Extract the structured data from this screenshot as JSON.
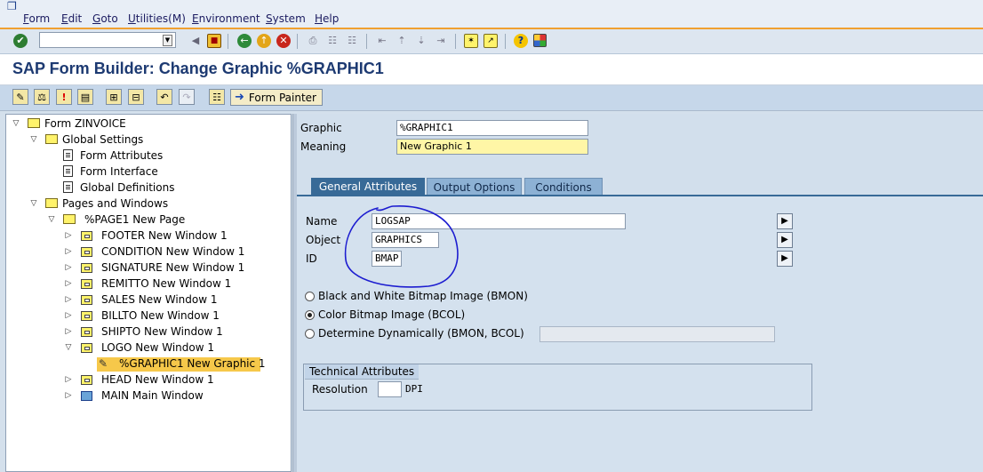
{
  "menubar": {
    "items": [
      "Form",
      "Edit",
      "Goto",
      "Utilities(M)",
      "Environment",
      "System",
      "Help"
    ]
  },
  "toolbar": {
    "command_value": ""
  },
  "page_title": "SAP Form Builder: Change Graphic %GRAPHIC1",
  "app_toolbar": {
    "form_painter_label": "Form Painter"
  },
  "tree": {
    "form": "Form ZINVOICE",
    "global_settings": "Global Settings",
    "form_attributes": "Form Attributes",
    "form_interface": "Form Interface",
    "global_definitions": "Global Definitions",
    "pages_and_windows": "Pages and Windows",
    "page1": "%PAGE1 New Page",
    "footer": "FOOTER New Window 1",
    "condition": "CONDITION New Window 1",
    "signature": "SIGNATURE New Window 1",
    "remitto": "REMITTO New Window 1",
    "sales": "SALES New Window 1",
    "billto": "BILLTO New Window 1",
    "shipto": "SHIPTO New Window 1",
    "logo": "LOGO New Window 1",
    "graphic1": "%GRAPHIC1 New Graphic 1",
    "head": "HEAD New Window 1",
    "main": "MAIN Main Window"
  },
  "header_fields": {
    "graphic_label": "Graphic",
    "graphic_value": "%GRAPHIC1",
    "meaning_label": "Meaning",
    "meaning_value": "New Graphic 1"
  },
  "tabs": [
    "General Attributes",
    "Output Options",
    "Conditions"
  ],
  "general": {
    "name_label": "Name",
    "name_value": "LOGSAP",
    "object_label": "Object",
    "object_value": "GRAPHICS",
    "id_label": "ID",
    "id_value": "BMAP",
    "radio_bw": "Black and White Bitmap Image (BMON)",
    "radio_color": "Color Bitmap Image (BCOL)",
    "radio_dynamic": "Determine Dynamically (BMON, BCOL)",
    "dynamic_value": "",
    "selected_radio": "radio_color"
  },
  "technical": {
    "title": "Technical Attributes",
    "resolution_label": "Resolution",
    "resolution_value": "",
    "resolution_unit": "DPI"
  },
  "colors": {
    "title_text": "#1d3a72",
    "tab_active": "#386a97",
    "tab_inactive": "#8db1d4",
    "selection": "#f6c84a",
    "annotation": "#1d1dd0"
  }
}
